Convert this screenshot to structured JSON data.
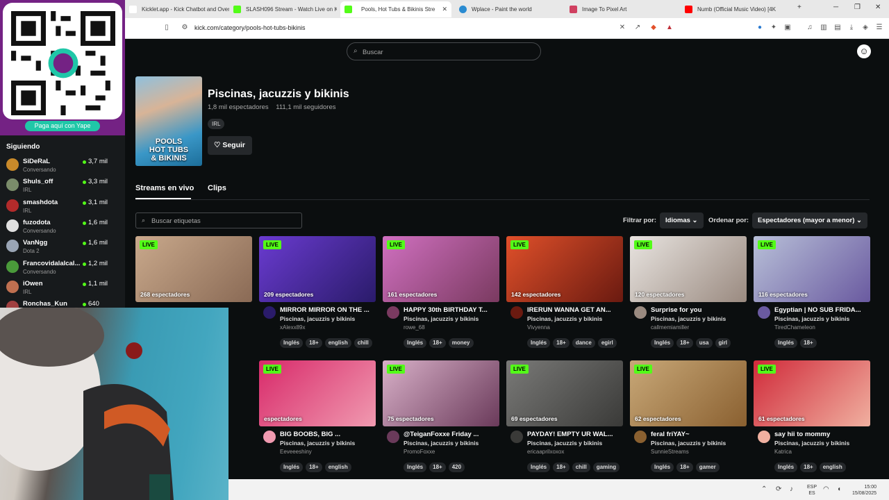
{
  "browser": {
    "tabs": [
      {
        "title": "Kicklet.app - Kick Chatbot and Overl",
        "icon": "kicklet-icon",
        "color": "#ffffff"
      },
      {
        "title": "SLASH096 Stream - Watch Live on Ki",
        "icon": "kick-icon",
        "color": "#53fc18"
      },
      {
        "title": "Pools, Hot Tubs & Bikinis Stre",
        "icon": "kick-icon",
        "color": "#53fc18"
      },
      {
        "title": "Wplace - Paint the world",
        "icon": "globe-icon",
        "color": "#2a8bd1"
      },
      {
        "title": "Image To Pixel Art",
        "icon": "heart-icon",
        "color": "#d04060"
      },
      {
        "title": "Numb (Official Music Video) [4K",
        "icon": "youtube-icon",
        "color": "#ff0000"
      }
    ],
    "url": "kick.com/category/pools-hot-tubs-bikinis"
  },
  "yape": {
    "button": "Paga aquí con Yape",
    "brand_color": "#742284",
    "qr_badge": "Yape"
  },
  "sidebar": {
    "title": "Siguiendo",
    "items": [
      {
        "name": "SiDeRaL",
        "category": "Conversando",
        "viewers": "3,7 mil",
        "color": "#c98a2a"
      },
      {
        "name": "Shuls_off",
        "category": "IRL",
        "viewers": "3,3 mil",
        "color": "#7a8c6a"
      },
      {
        "name": "smashdota",
        "category": "IRL",
        "viewers": "3,1 mil",
        "color": "#b22b2b"
      },
      {
        "name": "fuzodota",
        "category": "Conversando",
        "viewers": "1,6 mil",
        "color": "#e0e0e0"
      },
      {
        "name": "VanNgg",
        "category": "Dota 2",
        "viewers": "1,6 mil",
        "color": "#9aa5b5"
      },
      {
        "name": "Francovidalalcal...",
        "category": "Conversando",
        "viewers": "1,2 mil",
        "color": "#4a9a3a"
      },
      {
        "name": "iOwen",
        "category": "IRL",
        "viewers": "1,1 mil",
        "color": "#c07050"
      },
      {
        "name": "Ronchas_Kun",
        "category": "",
        "viewers": "640",
        "color": "#a04040"
      }
    ]
  },
  "header": {
    "search_placeholder": "Buscar"
  },
  "category": {
    "title": "Piscinas, jacuzzis y bikinis",
    "viewers": "1,8 mil espectadores",
    "followers": "111,1 mil seguidores",
    "tag": "IRL",
    "follow_label": "Seguir",
    "cover_text_1": "POOLS",
    "cover_text_2": "HOT TUBS",
    "cover_text_3": "& BIKINIS"
  },
  "tabs": {
    "live": "Streams en vivo",
    "clips": "Clips"
  },
  "filters": {
    "tag_search_placeholder": "Buscar etiquetas",
    "filter_label": "Filtrar por:",
    "filter_value": "Idiomas",
    "sort_label": "Ordenar por:",
    "sort_value": "Espectadores (mayor a menor)"
  },
  "live_badge": "LIVE",
  "streams": [
    {
      "viewers": "268 espectadores",
      "title": "",
      "category": "",
      "user": "",
      "tags": [],
      "thumb": "#c9a98c",
      "thumb2": "#8a6a55"
    },
    {
      "viewers": "209 espectadores",
      "title": "MIRROR MIRROR ON THE ...",
      "category": "Piscinas, jacuzzis y bikinis",
      "user": "xAlexx89x",
      "tags": [
        "Inglés",
        "18+",
        "english",
        "chill"
      ],
      "thumb": "#6a3bd0",
      "thumb2": "#2a1b6a"
    },
    {
      "viewers": "161 espectadores",
      "title": "HAPPY 30th BIRTHDAY T...",
      "category": "Piscinas, jacuzzis y bikinis",
      "user": "rowe_68",
      "tags": [
        "Inglés",
        "18+",
        "money"
      ],
      "thumb": "#d070c0",
      "thumb2": "#7a3a60"
    },
    {
      "viewers": "142 espectadores",
      "title": "IRERUN WANNA GET AN...",
      "category": "Piscinas, jacuzzis y bikinis",
      "user": "Vivyenna",
      "tags": [
        "Inglés",
        "18+",
        "dance",
        "egirl"
      ],
      "thumb": "#e0502a",
      "thumb2": "#6a1a10"
    },
    {
      "viewers": "120 espectadores",
      "title": "Surprise for you",
      "category": "Piscinas, jacuzzis y bikinis",
      "user": "callmemiamiller",
      "tags": [
        "Inglés",
        "18+",
        "usa",
        "girl"
      ],
      "thumb": "#e8e4e0",
      "thumb2": "#9a8a80"
    },
    {
      "viewers": "116 espectadores",
      "title": "Egyptian | NO SUB FRIDA...",
      "category": "Piscinas, jacuzzis y bikinis",
      "user": "TiredChameleon",
      "tags": [
        "Inglés",
        "18+"
      ],
      "thumb": "#b8c0d8",
      "thumb2": "#6a5aa0"
    },
    {
      "viewers": "espectadores",
      "title": "BIG BOOBS, BIG ...",
      "category": "Piscinas, jacuzzis y bikinis",
      "user": "Eeveeeshiny",
      "tags": [
        "Inglés",
        "18+",
        "english"
      ],
      "thumb": "#d82a6a",
      "thumb2": "#f09ab0"
    },
    {
      "viewers": "75 espectadores",
      "title": "@TeiganFoxxe Friday ...",
      "category": "Piscinas, jacuzzis y bikinis",
      "user": "PromoFoxxe",
      "tags": [
        "Inglés",
        "18+",
        "420"
      ],
      "thumb": "#d8b0c8",
      "thumb2": "#6a3a5a"
    },
    {
      "viewers": "69 espectadores",
      "title": "PAYDAY! EMPTY UR WAL...",
      "category": "Piscinas, jacuzzis y bikinis",
      "user": "ericaaprilxoxox",
      "tags": [
        "Inglés",
        "18+",
        "chill",
        "gaming"
      ],
      "thumb": "#7a7a78",
      "thumb2": "#3a3a38"
    },
    {
      "viewers": "62 espectadores",
      "title": "feral friYAY~",
      "category": "Piscinas, jacuzzis y bikinis",
      "user": "SunnieStreams",
      "tags": [
        "Inglés",
        "18+",
        "gamer"
      ],
      "thumb": "#c8a878",
      "thumb2": "#8a6030"
    },
    {
      "viewers": "61 espectadores",
      "title": "say hii to mommy",
      "category": "Piscinas, jacuzzis y bikinis",
      "user": "Katrica",
      "tags": [
        "Inglés",
        "18+",
        "english"
      ],
      "thumb": "#d02a3a",
      "thumb2": "#f0b0a0"
    }
  ],
  "taskbar": {
    "lang_1": "ESP",
    "lang_2": "ES",
    "time": "15:00",
    "date": "15/08/2025"
  }
}
